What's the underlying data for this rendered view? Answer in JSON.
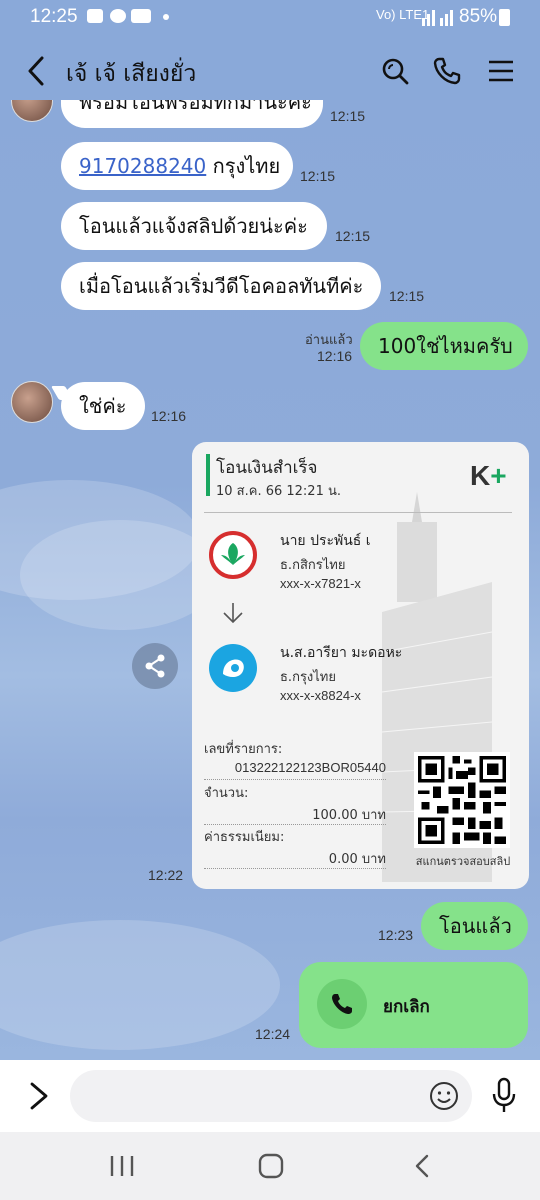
{
  "status_bar": {
    "time": "12:25",
    "signal_text": "Vo) LTE1",
    "battery": "85%"
  },
  "header": {
    "title": "เจ้ เจ้ เสียงยั่ว",
    "icons": [
      "back-icon",
      "search-icon",
      "phone-icon",
      "menu-icon"
    ]
  },
  "messages": [
    {
      "side": "in",
      "text": "พร้อมโอนพร้อมทักมานะคะ",
      "time": "12:15"
    },
    {
      "side": "in",
      "text_link": "9170288240",
      "text": " กรุงไทย",
      "time": "12:15"
    },
    {
      "side": "in",
      "text": "โอนแล้วแจ้งสลิปด้วยน่ะค่ะ",
      "time": "12:15"
    },
    {
      "side": "in",
      "text": "เมื่อโอนแล้วเริ่มวีดีโอคอลทันทีค่ะ",
      "time": "12:15"
    },
    {
      "side": "out",
      "text": "100ใช่ไหมครับ",
      "read": "อ่านแล้ว",
      "time": "12:16"
    },
    {
      "side": "in",
      "text": "ใช่ค่ะ",
      "time": "12:16"
    },
    {
      "side": "in",
      "type": "image",
      "time": "12:22"
    },
    {
      "side": "out",
      "text": "โอนแล้ว",
      "time": "12:23"
    },
    {
      "side": "out",
      "type": "call",
      "text": "ยกเลิก",
      "time": "12:24"
    }
  ],
  "slip": {
    "title": "โอนเงินสำเร็จ",
    "date": "10 ส.ค. 66  12:21 น.",
    "logo": "K",
    "logo_plus": "+",
    "from_name": "นาย ประพันธ์ เ",
    "from_bank": "ธ.กสิกรไทย",
    "from_account": "xxx-x-x7821-x",
    "to_name": "น.ส.อารียา มะดอหะ",
    "to_bank": "ธ.กรุงไทย",
    "to_account": "xxx-x-x8824-x",
    "ref_label": "เลขที่รายการ:",
    "ref_value": "013222122123BOR05440",
    "amount_label": "จำนวน:",
    "amount_value": "100.00 บาท",
    "fee_label": "ค่าธรรมเนียม:",
    "fee_value": "0.00 บาท",
    "qr_caption": "สแกนตรวจสอบสลิป",
    "from_bank_color": "#1aa760",
    "to_bank_color": "#1ba5e1"
  },
  "input": {
    "placeholder": ""
  },
  "colors": {
    "chat_background": "#8aa9d9",
    "outgoing_bubble": "#85e28a",
    "incoming_bubble": "#ffffff",
    "link": "#3a63c9"
  }
}
